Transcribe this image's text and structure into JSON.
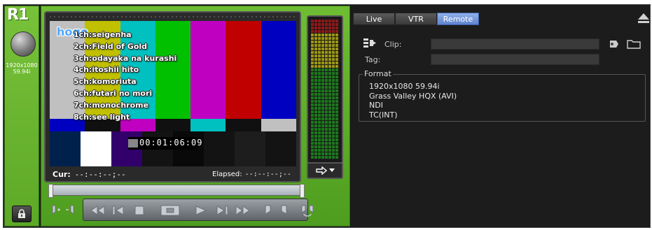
{
  "channel": {
    "label": "R1",
    "format_line1": "1920x1080",
    "format_line2": "59.94i"
  },
  "preview": {
    "overlay_title": "hoge",
    "overlay_lines": [
      "1ch:seigenha",
      "2ch:Field of Gold",
      "3ch:odayaka na kurashi",
      "4ch:itoshii hito",
      "5ch:komoriuta",
      "6ch:futari no mori",
      "7ch:monochrome",
      "8ch:see light"
    ],
    "timecode": "00:01:06:09",
    "cur_label": "Cur:",
    "cur_value": "--:--:--;--",
    "elapsed_label": "Elapsed:",
    "elapsed_value": "--:--:--;--",
    "bars_top_colors": [
      "#c0c0c0",
      "#c0c000",
      "#00c0c0",
      "#00c000",
      "#c000c0",
      "#c00000",
      "#0000c0"
    ],
    "bars_mid_colors": [
      "#0000c0",
      "#101010",
      "#c000c0",
      "#101010",
      "#00c0c0",
      "#101010",
      "#c0c0c0"
    ],
    "bars_bot_colors": [
      "#00214c",
      "#ffffff",
      "#32006a",
      "#131313",
      "#090909",
      "#131313",
      "#1d1d1d",
      "#131313"
    ]
  },
  "tabs": [
    {
      "label": "Live",
      "active": false
    },
    {
      "label": "VTR",
      "active": false
    },
    {
      "label": "Remote",
      "active": true
    }
  ],
  "remote": {
    "clip_label": "Clip:",
    "clip_value": "",
    "tag_label": "Tag:",
    "tag_value": "",
    "format_label": "Format",
    "format_lines": [
      "1920x1080 59.94i",
      "Grass Valley HQX (AVI)",
      "NDI",
      "TC(INT)"
    ]
  },
  "colors": {
    "accent_green": "#5da826",
    "tab_active": "#6f92d8",
    "meter_red": "#b81818",
    "meter_yellow": "#c8c010",
    "meter_green": "#1e9a1e"
  }
}
